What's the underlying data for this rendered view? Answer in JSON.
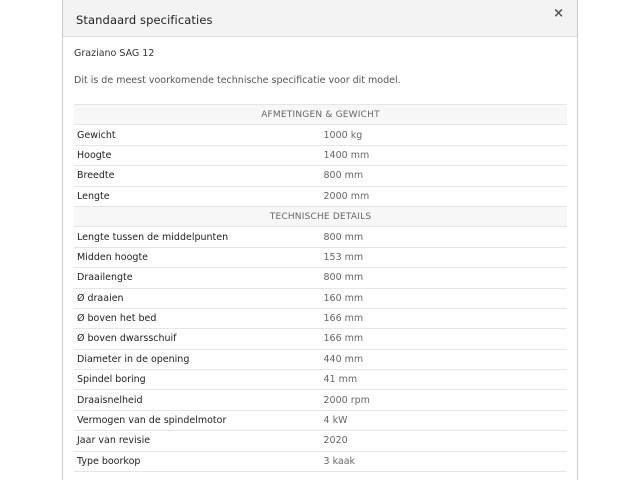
{
  "modal": {
    "title": "Standaard specificaties",
    "close_label": "×",
    "machine_name": "Graziano SAG 12",
    "intro": "Dit is de meest voorkomende technische specificatie voor dit model."
  },
  "sections": [
    {
      "heading": "AFMETINGEN & GEWICHT",
      "rows": [
        {
          "label": "Gewicht",
          "value": "1000 kg"
        },
        {
          "label": "Hoogte",
          "value": "1400 mm"
        },
        {
          "label": "Breedte",
          "value": "800 mm"
        },
        {
          "label": "Lengte",
          "value": "2000 mm"
        }
      ]
    },
    {
      "heading": "TECHNISCHE DETAILS",
      "rows": [
        {
          "label": "Lengte tussen de middelpunten",
          "value": "800 mm"
        },
        {
          "label": "Midden hoogte",
          "value": "153 mm"
        },
        {
          "label": "Draailengte",
          "value": "800 mm"
        },
        {
          "label": "Ø draaien",
          "value": "160 mm"
        },
        {
          "label": "Ø boven het bed",
          "value": "166 mm"
        },
        {
          "label": "Ø boven dwarsschuif",
          "value": "166 mm"
        },
        {
          "label": "Diameter in de opening",
          "value": "440 mm"
        },
        {
          "label": "Spindel boring",
          "value": "41 mm"
        },
        {
          "label": "Draaisnelheid",
          "value": "2000 rpm"
        },
        {
          "label": "Vermogen van de spindelmotor",
          "value": "4 kW"
        },
        {
          "label": "Jaar van revisie",
          "value": "2020"
        },
        {
          "label": "Type boorkop",
          "value": "3 kaak"
        }
      ]
    }
  ]
}
